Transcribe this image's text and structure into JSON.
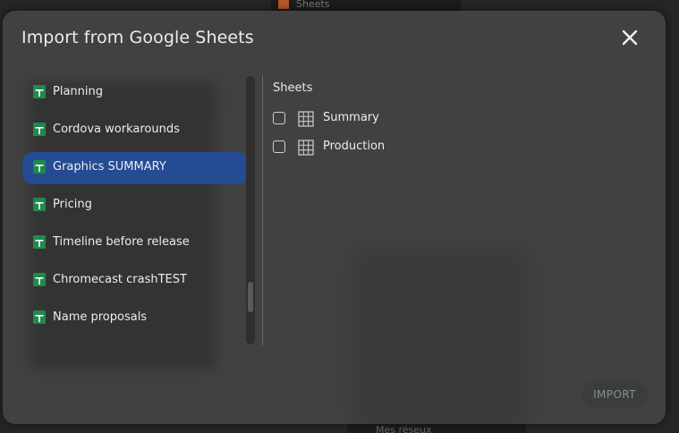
{
  "background": {
    "top_window_label": "Sheets",
    "bottom_window_label": "Mes réseux"
  },
  "dialog": {
    "title": "Import from Google Sheets",
    "close_icon": "close-icon"
  },
  "files": {
    "selected_index": 2,
    "items": [
      {
        "label": "Planning",
        "icon": "google-sheets-icon"
      },
      {
        "label": "Cordova workarounds",
        "icon": "google-sheets-icon"
      },
      {
        "label": "Graphics SUMMARY",
        "icon": "google-sheets-icon"
      },
      {
        "label": "Pricing",
        "icon": "google-sheets-icon"
      },
      {
        "label": "Timeline before release",
        "icon": "google-sheets-icon"
      },
      {
        "label": "Chromecast crashTEST",
        "icon": "google-sheets-icon"
      },
      {
        "label": "Name proposals",
        "icon": "google-sheets-icon"
      }
    ]
  },
  "sheets": {
    "heading": "Sheets",
    "items": [
      {
        "label": "Summary",
        "checked": false,
        "icon": "table-icon"
      },
      {
        "label": "Production",
        "checked": false,
        "icon": "table-icon"
      }
    ]
  },
  "footer": {
    "import_label": "IMPORT"
  },
  "colors": {
    "dialog_bg": "#414141",
    "selected_bg": "#254b93",
    "sheets_icon_green": "#1f8a4c"
  }
}
